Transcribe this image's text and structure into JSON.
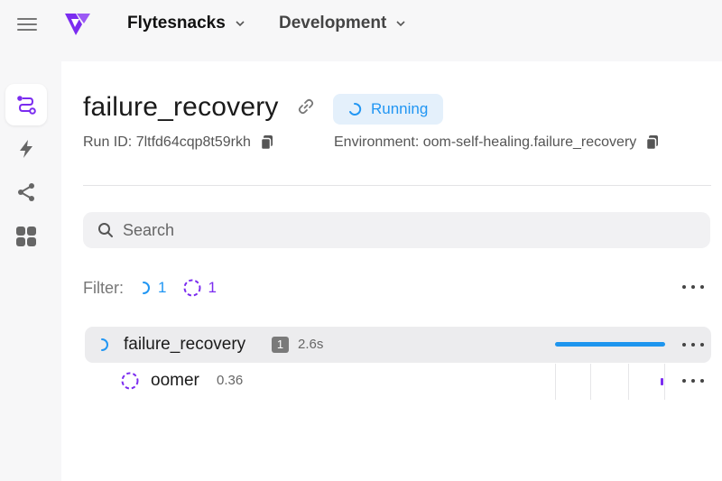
{
  "app": {
    "project": "Flytesnacks",
    "domain": "Development"
  },
  "sidebar": {
    "items": [
      {
        "icon": "runs-icon",
        "active": true
      },
      {
        "icon": "lightning-icon",
        "active": false
      },
      {
        "icon": "share-icon",
        "active": false
      },
      {
        "icon": "apps-grid-icon",
        "active": false
      }
    ]
  },
  "run": {
    "name": "failure_recovery",
    "status": "Running",
    "run_id_label": "Run ID: 7ltfd64cqp8t59rkh",
    "environment_label": "Environment: oom-self-healing.failure_recovery"
  },
  "search": {
    "placeholder": "Search"
  },
  "filter": {
    "label": "Filter:",
    "running_count": "1",
    "queued_count": "1"
  },
  "tasks": [
    {
      "name": "failure_recovery",
      "count": "1",
      "duration": "2.6s",
      "status": "running",
      "progress": 1.0
    },
    {
      "name": "oomer",
      "duration": "0.36",
      "status": "queued"
    }
  ],
  "colors": {
    "running": "#1e95ee",
    "queued": "#7b2cf0",
    "brand": "#7b2cf0"
  }
}
